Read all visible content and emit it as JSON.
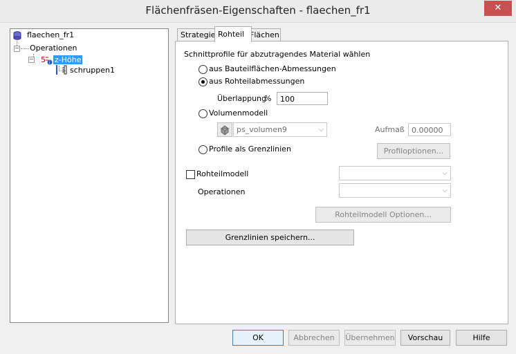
{
  "window": {
    "title": "Flächenfräsen-Eigenschaften - flaechen_fr1",
    "close_label": "✕"
  },
  "tree": {
    "root": "flaechen_fr1",
    "operations": "Operationen",
    "zhoehe": "z-Höhe",
    "schruppen": "schruppen1"
  },
  "tabs": [
    {
      "label": "Strategie"
    },
    {
      "label": "Rohteil"
    },
    {
      "label": "Flächen"
    }
  ],
  "rohteil": {
    "section_label": "Schnittprofile für abzutragendes Material wählen",
    "radio_bauteil": "aus Bauteilflächen-Abmessungen",
    "radio_rohteil": "aus Rohteilabmessungen",
    "overlap_label": "Überlappung",
    "overlap_unit": "%",
    "overlap_value": "100",
    "radio_volumen": "Volumenmodell",
    "volumen_select": "ps_volumen9",
    "aufmass_label": "Aufmaß",
    "aufmass_value": "0.00000",
    "radio_profile": "Profile als Grenzlinien",
    "profiloptionen_button": "Profiloptionen...",
    "rohteilmodell_label": "Rohteilmodell",
    "rohteilmodell_select": "",
    "operationen_label": "Operationen",
    "operationen_select": "",
    "rohteilmodell_optionen_button": "Rohteilmodell Optionen...",
    "grenzlinien_button": "Grenzlinien speichern..."
  },
  "footer": {
    "ok": "OK",
    "cancel": "Abbrechen",
    "apply": "Übernehmen",
    "preview": "Vorschau",
    "help": "Hilfe"
  }
}
